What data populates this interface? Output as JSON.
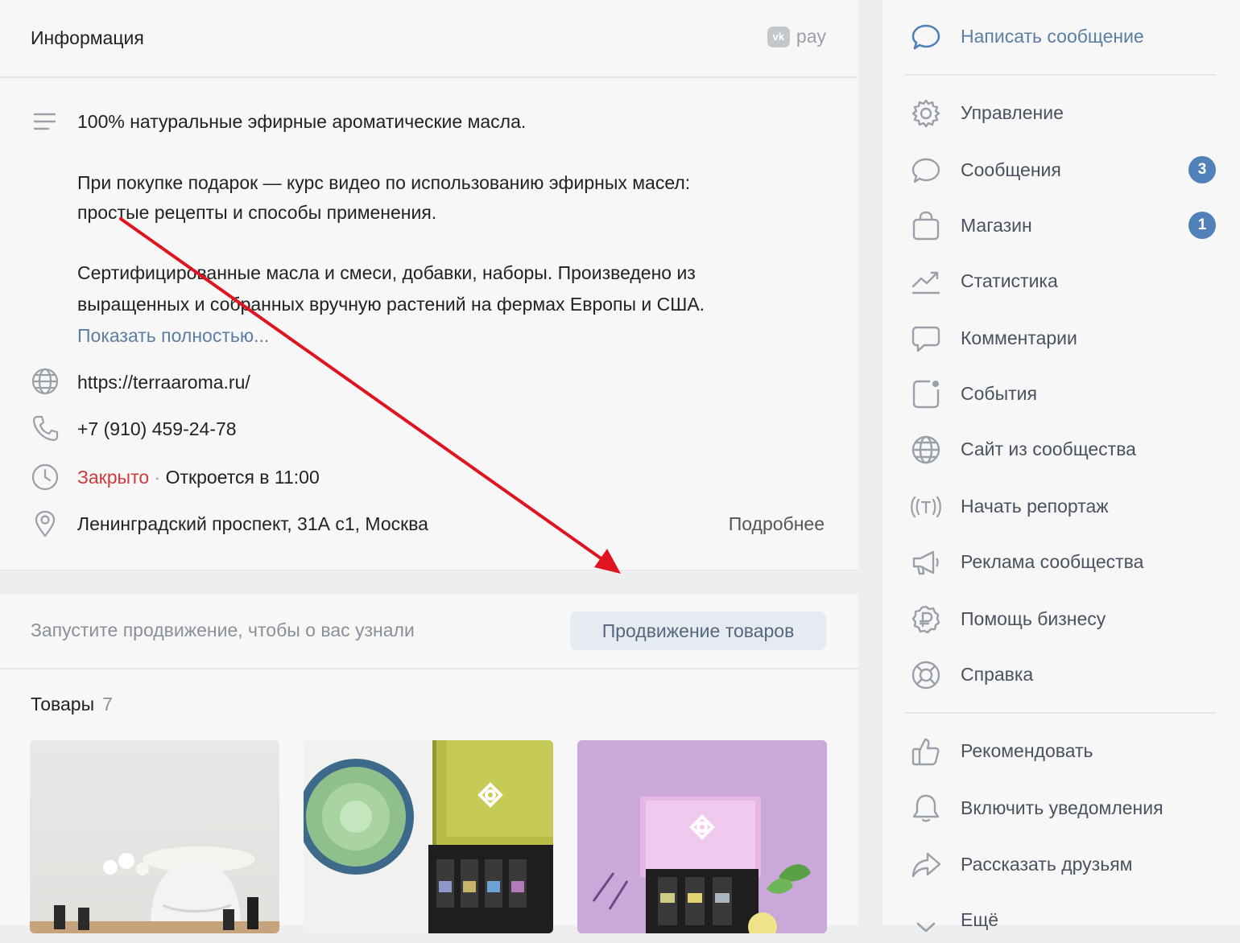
{
  "info": {
    "title": "Информация",
    "vkpay_logo": "vk",
    "vkpay_label": "pay",
    "description": [
      "100% натуральные эфирные ароматические масла.",
      "При покупке подарок — курс видео по использованию эфирных масел:",
      "простые рецепты и способы применения.",
      "Сертифицированные масла и смеси, добавки, наборы. Произведено из",
      "выращенных и собранных вручную растений на фермах Европы и США."
    ],
    "show_more": "Показать полностью...",
    "website": "https://terraaroma.ru/",
    "phone": "+7 (910) 459-24-78",
    "status_closed": "Закрыто",
    "status_separator": "·",
    "opens_at": "Откроется в 11:00",
    "address": "Ленинградский проспект, 31А с1, Москва",
    "details_link": "Подробнее"
  },
  "promo": {
    "text": "Запустите продвижение, чтобы о вас узнали",
    "button": "Продвижение товаров"
  },
  "goods": {
    "title": "Товары",
    "count": "7"
  },
  "menu": {
    "items": [
      {
        "label": "Написать сообщение",
        "icon": "message-bubble-icon"
      },
      {
        "label": "Управление",
        "icon": "gear-icon"
      },
      {
        "label": "Сообщения",
        "icon": "chat-icon",
        "badge": "3"
      },
      {
        "label": "Магазин",
        "icon": "shopping-bag-icon",
        "badge": "1"
      },
      {
        "label": "Статистика",
        "icon": "chart-line-icon"
      },
      {
        "label": "Комментарии",
        "icon": "comment-icon"
      },
      {
        "label": "События",
        "icon": "event-icon"
      },
      {
        "label": "Сайт из сообщества",
        "icon": "globe-icon"
      },
      {
        "label": "Начать репортаж",
        "icon": "live-broadcast-icon"
      },
      {
        "label": "Реклама сообщества",
        "icon": "megaphone-icon"
      },
      {
        "label": "Помощь бизнесу",
        "icon": "ruble-coin-icon"
      },
      {
        "label": "Справка",
        "icon": "lifebuoy-icon"
      },
      {
        "label": "Рекомендовать",
        "icon": "thumbs-up-icon"
      },
      {
        "label": "Включить уведомления",
        "icon": "bell-icon"
      },
      {
        "label": "Рассказать друзьям",
        "icon": "share-arrow-icon"
      },
      {
        "label": "Ещё",
        "icon": "chevron-down-icon"
      }
    ]
  },
  "colors": {
    "accent": "#5181b8",
    "link": "#5b7ea3",
    "closed": "#d3393a",
    "annotation_arrow": "#e0141e"
  }
}
